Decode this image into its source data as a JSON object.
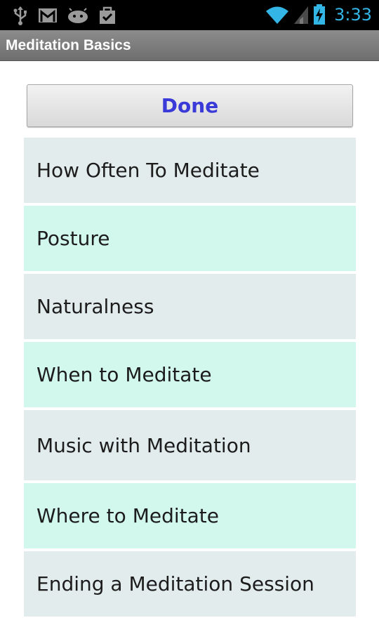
{
  "status_bar": {
    "time": "3:33",
    "icons": [
      "usb-icon",
      "gmail-icon",
      "android-debug-icon",
      "download-done-icon",
      "wifi-icon",
      "signal-icon",
      "battery-charging-icon"
    ],
    "accent_color": "#33b5e5"
  },
  "title_bar": {
    "title": "Meditation Basics"
  },
  "done_button": {
    "label": "Done",
    "color": "#3a3ad8"
  },
  "topics": [
    "How Often To Meditate",
    "Posture",
    "Naturalness",
    "When to Meditate",
    "Music with Meditation",
    "Where to Meditate",
    "Ending a Meditation Session"
  ],
  "colors": {
    "row_odd": "#e3ecec",
    "row_even": "#d2f7ec"
  }
}
